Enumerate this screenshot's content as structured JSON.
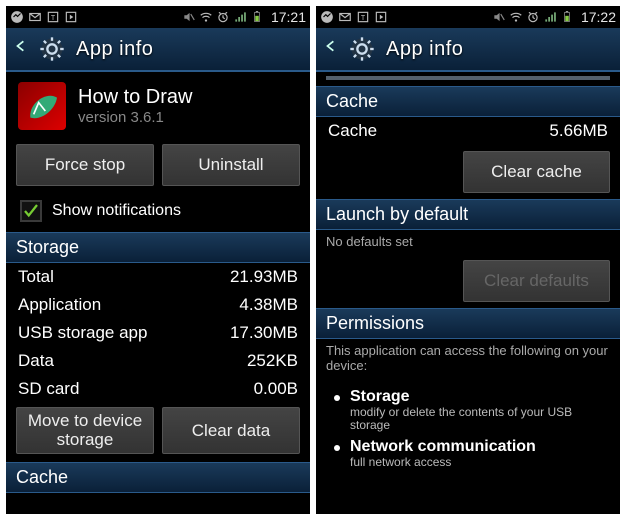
{
  "left": {
    "time": "17:21",
    "header": {
      "title": "App info"
    },
    "app": {
      "name": "How to Draw",
      "version": "version 3.6.1"
    },
    "buttons": {
      "force_stop": "Force stop",
      "uninstall": "Uninstall"
    },
    "notifications": {
      "label": "Show notifications",
      "checked": true
    },
    "storage_head": "Storage",
    "storage": {
      "total_label": "Total",
      "total_value": "21.93MB",
      "app_label": "Application",
      "app_value": "4.38MB",
      "usb_label": "USB storage app",
      "usb_value": "17.30MB",
      "data_label": "Data",
      "data_value": "252KB",
      "sd_label": "SD card",
      "sd_value": "0.00B"
    },
    "storage_buttons": {
      "move": "Move to device storage",
      "clear_data": "Clear data"
    },
    "cache_head": "Cache"
  },
  "right": {
    "time": "17:22",
    "header": {
      "title": "App info"
    },
    "cache_head": "Cache",
    "cache": {
      "label": "Cache",
      "value": "5.66MB",
      "clear": "Clear cache"
    },
    "launch_head": "Launch by default",
    "launch": {
      "none": "No defaults set",
      "clear": "Clear defaults"
    },
    "perm_head": "Permissions",
    "perm_intro": "This application can access the following on your device:",
    "perms": {
      "storage_title": "Storage",
      "storage_desc": "modify or delete the contents of your USB storage",
      "net_title": "Network communication",
      "net_desc": "full network access"
    }
  }
}
